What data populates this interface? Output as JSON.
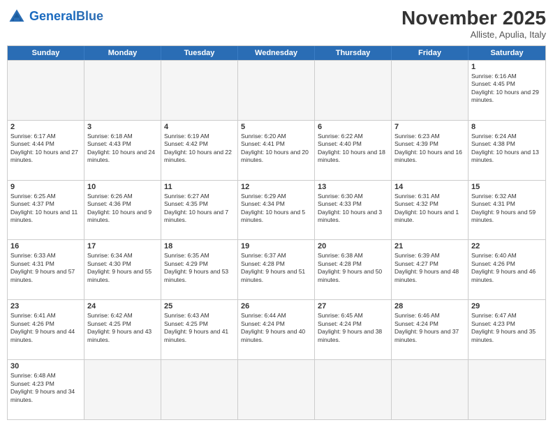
{
  "header": {
    "logo_general": "General",
    "logo_blue": "Blue",
    "month_title": "November 2025",
    "subtitle": "Alliste, Apulia, Italy"
  },
  "days_of_week": [
    "Sunday",
    "Monday",
    "Tuesday",
    "Wednesday",
    "Thursday",
    "Friday",
    "Saturday"
  ],
  "weeks": [
    [
      {
        "day": "",
        "info": "",
        "empty": true
      },
      {
        "day": "",
        "info": "",
        "empty": true
      },
      {
        "day": "",
        "info": "",
        "empty": true
      },
      {
        "day": "",
        "info": "",
        "empty": true
      },
      {
        "day": "",
        "info": "",
        "empty": true
      },
      {
        "day": "",
        "info": "",
        "empty": true
      },
      {
        "day": "1",
        "info": "Sunrise: 6:16 AM\nSunset: 4:45 PM\nDaylight: 10 hours and 29 minutes.",
        "empty": false
      }
    ],
    [
      {
        "day": "2",
        "info": "Sunrise: 6:17 AM\nSunset: 4:44 PM\nDaylight: 10 hours and 27 minutes.",
        "empty": false
      },
      {
        "day": "3",
        "info": "Sunrise: 6:18 AM\nSunset: 4:43 PM\nDaylight: 10 hours and 24 minutes.",
        "empty": false
      },
      {
        "day": "4",
        "info": "Sunrise: 6:19 AM\nSunset: 4:42 PM\nDaylight: 10 hours and 22 minutes.",
        "empty": false
      },
      {
        "day": "5",
        "info": "Sunrise: 6:20 AM\nSunset: 4:41 PM\nDaylight: 10 hours and 20 minutes.",
        "empty": false
      },
      {
        "day": "6",
        "info": "Sunrise: 6:22 AM\nSunset: 4:40 PM\nDaylight: 10 hours and 18 minutes.",
        "empty": false
      },
      {
        "day": "7",
        "info": "Sunrise: 6:23 AM\nSunset: 4:39 PM\nDaylight: 10 hours and 16 minutes.",
        "empty": false
      },
      {
        "day": "8",
        "info": "Sunrise: 6:24 AM\nSunset: 4:38 PM\nDaylight: 10 hours and 13 minutes.",
        "empty": false
      }
    ],
    [
      {
        "day": "9",
        "info": "Sunrise: 6:25 AM\nSunset: 4:37 PM\nDaylight: 10 hours and 11 minutes.",
        "empty": false
      },
      {
        "day": "10",
        "info": "Sunrise: 6:26 AM\nSunset: 4:36 PM\nDaylight: 10 hours and 9 minutes.",
        "empty": false
      },
      {
        "day": "11",
        "info": "Sunrise: 6:27 AM\nSunset: 4:35 PM\nDaylight: 10 hours and 7 minutes.",
        "empty": false
      },
      {
        "day": "12",
        "info": "Sunrise: 6:29 AM\nSunset: 4:34 PM\nDaylight: 10 hours and 5 minutes.",
        "empty": false
      },
      {
        "day": "13",
        "info": "Sunrise: 6:30 AM\nSunset: 4:33 PM\nDaylight: 10 hours and 3 minutes.",
        "empty": false
      },
      {
        "day": "14",
        "info": "Sunrise: 6:31 AM\nSunset: 4:32 PM\nDaylight: 10 hours and 1 minute.",
        "empty": false
      },
      {
        "day": "15",
        "info": "Sunrise: 6:32 AM\nSunset: 4:31 PM\nDaylight: 9 hours and 59 minutes.",
        "empty": false
      }
    ],
    [
      {
        "day": "16",
        "info": "Sunrise: 6:33 AM\nSunset: 4:31 PM\nDaylight: 9 hours and 57 minutes.",
        "empty": false
      },
      {
        "day": "17",
        "info": "Sunrise: 6:34 AM\nSunset: 4:30 PM\nDaylight: 9 hours and 55 minutes.",
        "empty": false
      },
      {
        "day": "18",
        "info": "Sunrise: 6:35 AM\nSunset: 4:29 PM\nDaylight: 9 hours and 53 minutes.",
        "empty": false
      },
      {
        "day": "19",
        "info": "Sunrise: 6:37 AM\nSunset: 4:28 PM\nDaylight: 9 hours and 51 minutes.",
        "empty": false
      },
      {
        "day": "20",
        "info": "Sunrise: 6:38 AM\nSunset: 4:28 PM\nDaylight: 9 hours and 50 minutes.",
        "empty": false
      },
      {
        "day": "21",
        "info": "Sunrise: 6:39 AM\nSunset: 4:27 PM\nDaylight: 9 hours and 48 minutes.",
        "empty": false
      },
      {
        "day": "22",
        "info": "Sunrise: 6:40 AM\nSunset: 4:26 PM\nDaylight: 9 hours and 46 minutes.",
        "empty": false
      }
    ],
    [
      {
        "day": "23",
        "info": "Sunrise: 6:41 AM\nSunset: 4:26 PM\nDaylight: 9 hours and 44 minutes.",
        "empty": false
      },
      {
        "day": "24",
        "info": "Sunrise: 6:42 AM\nSunset: 4:25 PM\nDaylight: 9 hours and 43 minutes.",
        "empty": false
      },
      {
        "day": "25",
        "info": "Sunrise: 6:43 AM\nSunset: 4:25 PM\nDaylight: 9 hours and 41 minutes.",
        "empty": false
      },
      {
        "day": "26",
        "info": "Sunrise: 6:44 AM\nSunset: 4:24 PM\nDaylight: 9 hours and 40 minutes.",
        "empty": false
      },
      {
        "day": "27",
        "info": "Sunrise: 6:45 AM\nSunset: 4:24 PM\nDaylight: 9 hours and 38 minutes.",
        "empty": false
      },
      {
        "day": "28",
        "info": "Sunrise: 6:46 AM\nSunset: 4:24 PM\nDaylight: 9 hours and 37 minutes.",
        "empty": false
      },
      {
        "day": "29",
        "info": "Sunrise: 6:47 AM\nSunset: 4:23 PM\nDaylight: 9 hours and 35 minutes.",
        "empty": false
      }
    ],
    [
      {
        "day": "30",
        "info": "Sunrise: 6:48 AM\nSunset: 4:23 PM\nDaylight: 9 hours and 34 minutes.",
        "empty": false
      },
      {
        "day": "",
        "info": "",
        "empty": true
      },
      {
        "day": "",
        "info": "",
        "empty": true
      },
      {
        "day": "",
        "info": "",
        "empty": true
      },
      {
        "day": "",
        "info": "",
        "empty": true
      },
      {
        "day": "",
        "info": "",
        "empty": true
      },
      {
        "day": "",
        "info": "",
        "empty": true
      }
    ]
  ]
}
